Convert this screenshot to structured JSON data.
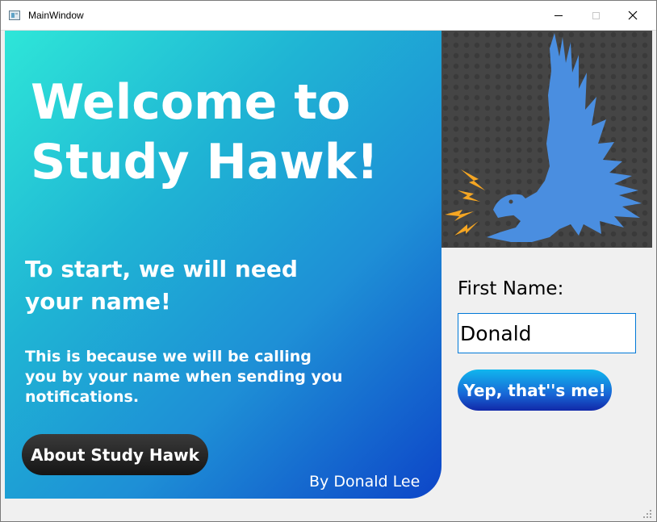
{
  "window": {
    "title": "MainWindow",
    "controls": {
      "minimize": "minimize",
      "maximize": "maximize",
      "close": "close"
    }
  },
  "welcome_panel": {
    "heading": "Welcome to Study Hawk!",
    "subheading": "To start, we will need your name!",
    "explanation": "This is because we will be calling you by your name when sending you notifications.",
    "about_button": "About Study Hawk",
    "author": "By Donald Lee"
  },
  "form": {
    "first_name_label": "First Name:",
    "first_name_value": "Donald",
    "confirm_button": "Yep, that''s me!"
  },
  "image": {
    "icon": "hawk-icon",
    "hawk_color": "#4a8ee0",
    "lightning_color": "#f5a623"
  },
  "colors": {
    "gradient_start": "#2ee6d8",
    "gradient_end": "#0d45c8",
    "about_button": "#1e1e1e",
    "confirm_button": "#1867d6"
  }
}
